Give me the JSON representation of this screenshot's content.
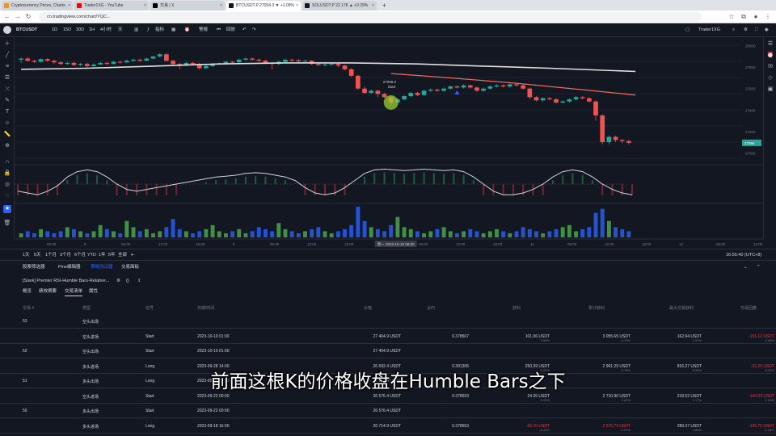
{
  "browser": {
    "tabs": [
      {
        "title": "Cryptocurrency Prices, Charts",
        "color": "#f7931a",
        "active": false
      },
      {
        "title": "Trader1XG - YouTube",
        "color": "#ff0000",
        "active": false
      },
      {
        "title": "交易 | X",
        "color": "#000000",
        "active": false
      },
      {
        "title": "BTCUSDT.P 27094.3 ▼ +1.09%",
        "color": "#131722",
        "active": true
      },
      {
        "title": "SOLUSDT.P 22.178 ▲ +0.29%",
        "color": "#131722",
        "active": false
      }
    ],
    "new_tab": "+",
    "url": "cn.tradingview.com/chart/YQC...",
    "back": "←",
    "forward": "→",
    "reload": "↻"
  },
  "toolbar": {
    "symbol": "BTCUSDT",
    "intervals": [
      "1D",
      "15D",
      "30D",
      "1H",
      "4小时",
      "天"
    ],
    "active_interval": "1H",
    "indicators": "指标",
    "alert": "警报",
    "replay": "回放",
    "account": "Trader1XG"
  },
  "chart": {
    "price_labels": [
      "28000",
      "27800",
      "27600",
      "27400",
      "27200",
      "27000"
    ],
    "last_price": "27094",
    "annotation_price": "27090.0",
    "annotation_label": "Start",
    "time_labels": [
      "06:00",
      "8",
      "06:00",
      "12:00",
      "18:00",
      "9",
      "06:00",
      "12:00",
      "18:00",
      "10",
      "06:00",
      "12:00",
      "18:00",
      "11",
      "06:00",
      "12:00",
      "18:00",
      "12",
      "06:00",
      "12:00"
    ],
    "cursor_time": "周一 2023-10-10 06:00",
    "clock": "16:55:40 (UTC+8)",
    "colors": {
      "up": "#26a69a",
      "down": "#ef5350",
      "ma": "#e0e0e0",
      "trail": "#f06a5a",
      "highlight": "#9acd32"
    }
  },
  "chart_data": {
    "type": "candlestick",
    "candles": [
      [
        27870,
        27880,
        27840,
        27890
      ],
      [
        27880,
        27860,
        27850,
        27895
      ],
      [
        27860,
        27850,
        27840,
        27870
      ],
      [
        27850,
        27875,
        27845,
        27880
      ],
      [
        27875,
        27860,
        27850,
        27885
      ],
      [
        27860,
        27845,
        27830,
        27870
      ],
      [
        27845,
        27830,
        27820,
        27855
      ],
      [
        27830,
        27840,
        27820,
        27850
      ],
      [
        27840,
        27820,
        27810,
        27850
      ],
      [
        27820,
        27830,
        27810,
        27840
      ],
      [
        27830,
        27810,
        27795,
        27840
      ],
      [
        27810,
        27825,
        27800,
        27835
      ],
      [
        27825,
        27840,
        27820,
        27850
      ],
      [
        27840,
        27830,
        27820,
        27850
      ],
      [
        27830,
        27850,
        27825,
        27860
      ],
      [
        27850,
        27845,
        27835,
        27860
      ],
      [
        27845,
        27860,
        27840,
        27870
      ],
      [
        27860,
        27870,
        27850,
        27880
      ],
      [
        27870,
        27860,
        27850,
        27880
      ],
      [
        27860,
        27880,
        27855,
        27890
      ],
      [
        27880,
        27900,
        27875,
        27905
      ],
      [
        27900,
        27920,
        27890,
        27930
      ],
      [
        27920,
        27860,
        27850,
        27930
      ],
      [
        27860,
        27830,
        27820,
        27870
      ],
      [
        27830,
        27820,
        27780,
        27840
      ],
      [
        27820,
        27840,
        27810,
        27850
      ],
      [
        27840,
        27830,
        27820,
        27850
      ],
      [
        27830,
        27790,
        27780,
        27840
      ],
      [
        27790,
        27810,
        27780,
        27820
      ],
      [
        27810,
        27830,
        27800,
        27840
      ],
      [
        27830,
        27835,
        27820,
        27845
      ],
      [
        27835,
        27850,
        27830,
        27860
      ],
      [
        27850,
        27845,
        27835,
        27860
      ],
      [
        27845,
        27870,
        27840,
        27880
      ],
      [
        27870,
        27880,
        27860,
        27890
      ],
      [
        27880,
        27870,
        27860,
        27890
      ],
      [
        27870,
        27860,
        27850,
        27880
      ],
      [
        27860,
        27840,
        27830,
        27870
      ],
      [
        27840,
        27830,
        27780,
        27845
      ],
      [
        27830,
        27850,
        27820,
        27860
      ],
      [
        27850,
        27870,
        27845,
        27880
      ],
      [
        27870,
        27865,
        27850,
        27880
      ],
      [
        27865,
        27855,
        27845,
        27875
      ],
      [
        27855,
        27860,
        27845,
        27870
      ],
      [
        27860,
        27830,
        27820,
        27865
      ],
      [
        27830,
        27820,
        27810,
        27840
      ],
      [
        27820,
        27825,
        27810,
        27835
      ],
      [
        27825,
        27830,
        27815,
        27840
      ],
      [
        27830,
        27815,
        27800,
        27840
      ],
      [
        27815,
        27780,
        27770,
        27820
      ],
      [
        27780,
        27720,
        27710,
        27790
      ],
      [
        27720,
        27600,
        27590,
        27730
      ],
      [
        27600,
        27560,
        27550,
        27620
      ],
      [
        27560,
        27580,
        27550,
        27590
      ],
      [
        27580,
        27550,
        27520,
        27590
      ],
      [
        27550,
        27520,
        27510,
        27560
      ],
      [
        27520,
        27470,
        27440,
        27530
      ],
      [
        27470,
        27500,
        27460,
        27510
      ],
      [
        27500,
        27530,
        27490,
        27540
      ],
      [
        27530,
        27560,
        27520,
        27570
      ],
      [
        27560,
        27540,
        27530,
        27570
      ],
      [
        27540,
        27580,
        27530,
        27590
      ],
      [
        27580,
        27590,
        27570,
        27600
      ],
      [
        27590,
        27580,
        27570,
        27600
      ],
      [
        27580,
        27600,
        27570,
        27610
      ],
      [
        27600,
        27620,
        27590,
        27630
      ],
      [
        27620,
        27610,
        27600,
        27630
      ],
      [
        27610,
        27630,
        27600,
        27640
      ],
      [
        27630,
        27610,
        27600,
        27640
      ],
      [
        27610,
        27580,
        27570,
        27620
      ],
      [
        27580,
        27600,
        27570,
        27610
      ],
      [
        27600,
        27620,
        27590,
        27630
      ],
      [
        27620,
        27630,
        27610,
        27640
      ],
      [
        27630,
        27620,
        27610,
        27640
      ],
      [
        27620,
        27640,
        27610,
        27650
      ],
      [
        27640,
        27630,
        27620,
        27650
      ],
      [
        27630,
        27600,
        27590,
        27640
      ],
      [
        27600,
        27520,
        27500,
        27610
      ],
      [
        27520,
        27490,
        27480,
        27530
      ],
      [
        27490,
        27510,
        27480,
        27520
      ],
      [
        27510,
        27500,
        27490,
        27520
      ],
      [
        27500,
        27470,
        27460,
        27510
      ],
      [
        27470,
        27480,
        27460,
        27490
      ],
      [
        27480,
        27500,
        27470,
        27510
      ],
      [
        27500,
        27520,
        27490,
        27530
      ],
      [
        27520,
        27510,
        27500,
        27530
      ],
      [
        27510,
        27480,
        27470,
        27520
      ],
      [
        27480,
        27350,
        27300,
        27490
      ],
      [
        27350,
        27100,
        27080,
        27360
      ],
      [
        27100,
        27150,
        27080,
        27160
      ],
      [
        27150,
        27120,
        27100,
        27160
      ],
      [
        27120,
        27110,
        27090,
        27130
      ],
      [
        27110,
        27094,
        27080,
        27120
      ]
    ],
    "ylim": [
      26950,
      28050
    ],
    "ma_path": [
      [
        0,
        27780
      ],
      [
        10,
        27790
      ],
      [
        20,
        27810
      ],
      [
        30,
        27830
      ],
      [
        40,
        27840
      ],
      [
        50,
        27840
      ],
      [
        60,
        27830
      ],
      [
        70,
        27810
      ],
      [
        80,
        27790
      ],
      [
        93,
        27760
      ]
    ],
    "trail_path": [
      [
        56,
        27740
      ],
      [
        65,
        27700
      ],
      [
        75,
        27650
      ],
      [
        85,
        27590
      ],
      [
        93,
        27540
      ]
    ],
    "oscillator": [
      0.3,
      0.25,
      0.2,
      0.3,
      0.45,
      0.7,
      0.85,
      0.9,
      0.85,
      0.7,
      0.5,
      0.35,
      0.3,
      0.35,
      0.4,
      0.45,
      0.5,
      0.55,
      0.6,
      0.65,
      0.7,
      0.72,
      0.75,
      0.8,
      0.82,
      0.8,
      0.75,
      0.7,
      0.6,
      0.4,
      0.25,
      0.2,
      0.25,
      0.4,
      0.6,
      0.8,
      0.9,
      0.92,
      0.9,
      0.88,
      0.9,
      0.92,
      0.9,
      0.88,
      0.9,
      0.85,
      0.7,
      0.5,
      0.3,
      0.2,
      0.2,
      0.25,
      0.35,
      0.5,
      0.7,
      0.85,
      0.9,
      0.85,
      0.7,
      0.5,
      0.35,
      0.25,
      0.2
    ],
    "volume": [
      2,
      3,
      2,
      4,
      3,
      2,
      3,
      5,
      4,
      3,
      2,
      3,
      6,
      4,
      3,
      2,
      8,
      5,
      3,
      4,
      2,
      3,
      5,
      9,
      4,
      3,
      2,
      3,
      4,
      6,
      3,
      2,
      3,
      4,
      2,
      3,
      5,
      4,
      3,
      7,
      4,
      3,
      2,
      3,
      4,
      5,
      3,
      2,
      3,
      4,
      6,
      15,
      8,
      5,
      4,
      3,
      6,
      10,
      5,
      4,
      3,
      2,
      3,
      4,
      5,
      3,
      2,
      3,
      4,
      3,
      2,
      3,
      4,
      3,
      2,
      3,
      5,
      4,
      3,
      2,
      3,
      4,
      5,
      6,
      3,
      4,
      5,
      12,
      14,
      8,
      5,
      4,
      3
    ]
  },
  "timeframes": [
    "1天",
    "5天",
    "1个月",
    "3个月",
    "6个月",
    "YTD",
    "1年",
    "5年",
    "全部"
  ],
  "bottom_panel": {
    "tabs": [
      "股票筛选器",
      "Pine编辑器",
      "策略测试器",
      "交易面板"
    ],
    "active_tab": "策略测试器",
    "strategy_name": "[Stark] Premier RSI-Humble Bars-Relative...",
    "subtabs": [
      "概览",
      "绩效摘要",
      "交易清单",
      "属性"
    ],
    "active_subtab": "交易清单"
  },
  "trades_table": {
    "headers": [
      "交易 #",
      "类型",
      "信号",
      "日期/时间",
      "价格",
      "合约",
      "获利",
      "累计获利",
      "最大交易获利",
      "交易回撤"
    ],
    "rows": [
      {
        "no": "53",
        "type": "空头出场",
        "signal": "",
        "date": "",
        "price": "",
        "contracts": "",
        "profit": "",
        "profit_pct": "",
        "cum": "",
        "cum_pct": "",
        "runup": "",
        "runup_pct": "",
        "dd": "",
        "dd_pct": ""
      },
      {
        "no": "",
        "type": "空头进场",
        "signal": "Start",
        "date": "2023-10-10 01:00",
        "price": "27 404.9 USDT",
        "contracts": "0.378507",
        "profit": "101.06 USDT",
        "profit_pct": "0.98%",
        "cum": "3 055.65 USDT",
        "cum_pct": "0.79%",
        "runup": "162.94 USDT",
        "runup_pct": "1.57%",
        "dd": "-151.12 USDT",
        "dd_pct": "-1.46%"
      },
      {
        "no": "52",
        "type": "空头出场",
        "signal": "Start",
        "date": "2023-10-10 01:00",
        "price": "27 404.9 USDT",
        "contracts": "",
        "profit": "",
        "profit_pct": "",
        "cum": "",
        "cum_pct": "",
        "runup": "",
        "runup_pct": "",
        "dd": "",
        "dd_pct": ""
      },
      {
        "no": "",
        "type": "多头进场",
        "signal": "Long",
        "date": "2023-09-28 14:00",
        "price": "26 592.4 USDT",
        "contracts": "0.391305",
        "profit": "250.39 USDT",
        "profit_pct": "2.42%",
        "cum": "2 961.29 USDT",
        "cum_pct": "2.78%",
        "runup": "816.27 USDT",
        "runup_pct": "6.09%",
        "dd": "-32.25 USDT",
        "dd_pct": "-0.31%"
      },
      {
        "no": "51",
        "type": "多头出场",
        "signal": "Long",
        "date": "2023-09-28 14:00",
        "price": "26 592.4 USDT",
        "contracts": "",
        "profit": "",
        "profit_pct": "",
        "cum": "",
        "cum_pct": "",
        "runup": "",
        "runup_pct": "",
        "dd": "",
        "dd_pct": ""
      },
      {
        "no": "",
        "type": "空头进场",
        "signal": "Start",
        "date": "2023-09-22 00:00",
        "price": "26 576.4 USDT",
        "contracts": "0.378553",
        "profit": "24.35 USDT",
        "profit_pct": "0.24%",
        "cum": "2 710.90 USDT",
        "cum_pct": "0.62%",
        "runup": "218.52 USDT",
        "runup_pct": "2.17%",
        "dd": "-144.03 USDT",
        "dd_pct": "-1.40%"
      },
      {
        "no": "50",
        "type": "多头出场",
        "signal": "Start",
        "date": "2023-09-22 00:00",
        "price": "26 576.4 USDT",
        "contracts": "",
        "profit": "",
        "profit_pct": "",
        "cum": "",
        "cum_pct": "",
        "runup": "",
        "runup_pct": "",
        "dd": "",
        "dd_pct": ""
      },
      {
        "no": "",
        "type": "多头进场",
        "signal": "Long",
        "date": "2023-09-18 16:00",
        "price": "26 714.9 USDT",
        "contracts": "0.378563",
        "profit": "-56.70 USDT",
        "profit_pct": "-0.44%",
        "cum": "2 576.73 USDT",
        "cum_pct": "-0.51%",
        "runup": "289.37 USDT",
        "runup_pct": "2.85%",
        "dd": "-135.75 USDT",
        "dd_pct": "-1.34%"
      }
    ]
  },
  "subtitle": "前面这根K的价格收盘在Humble Bars之下"
}
